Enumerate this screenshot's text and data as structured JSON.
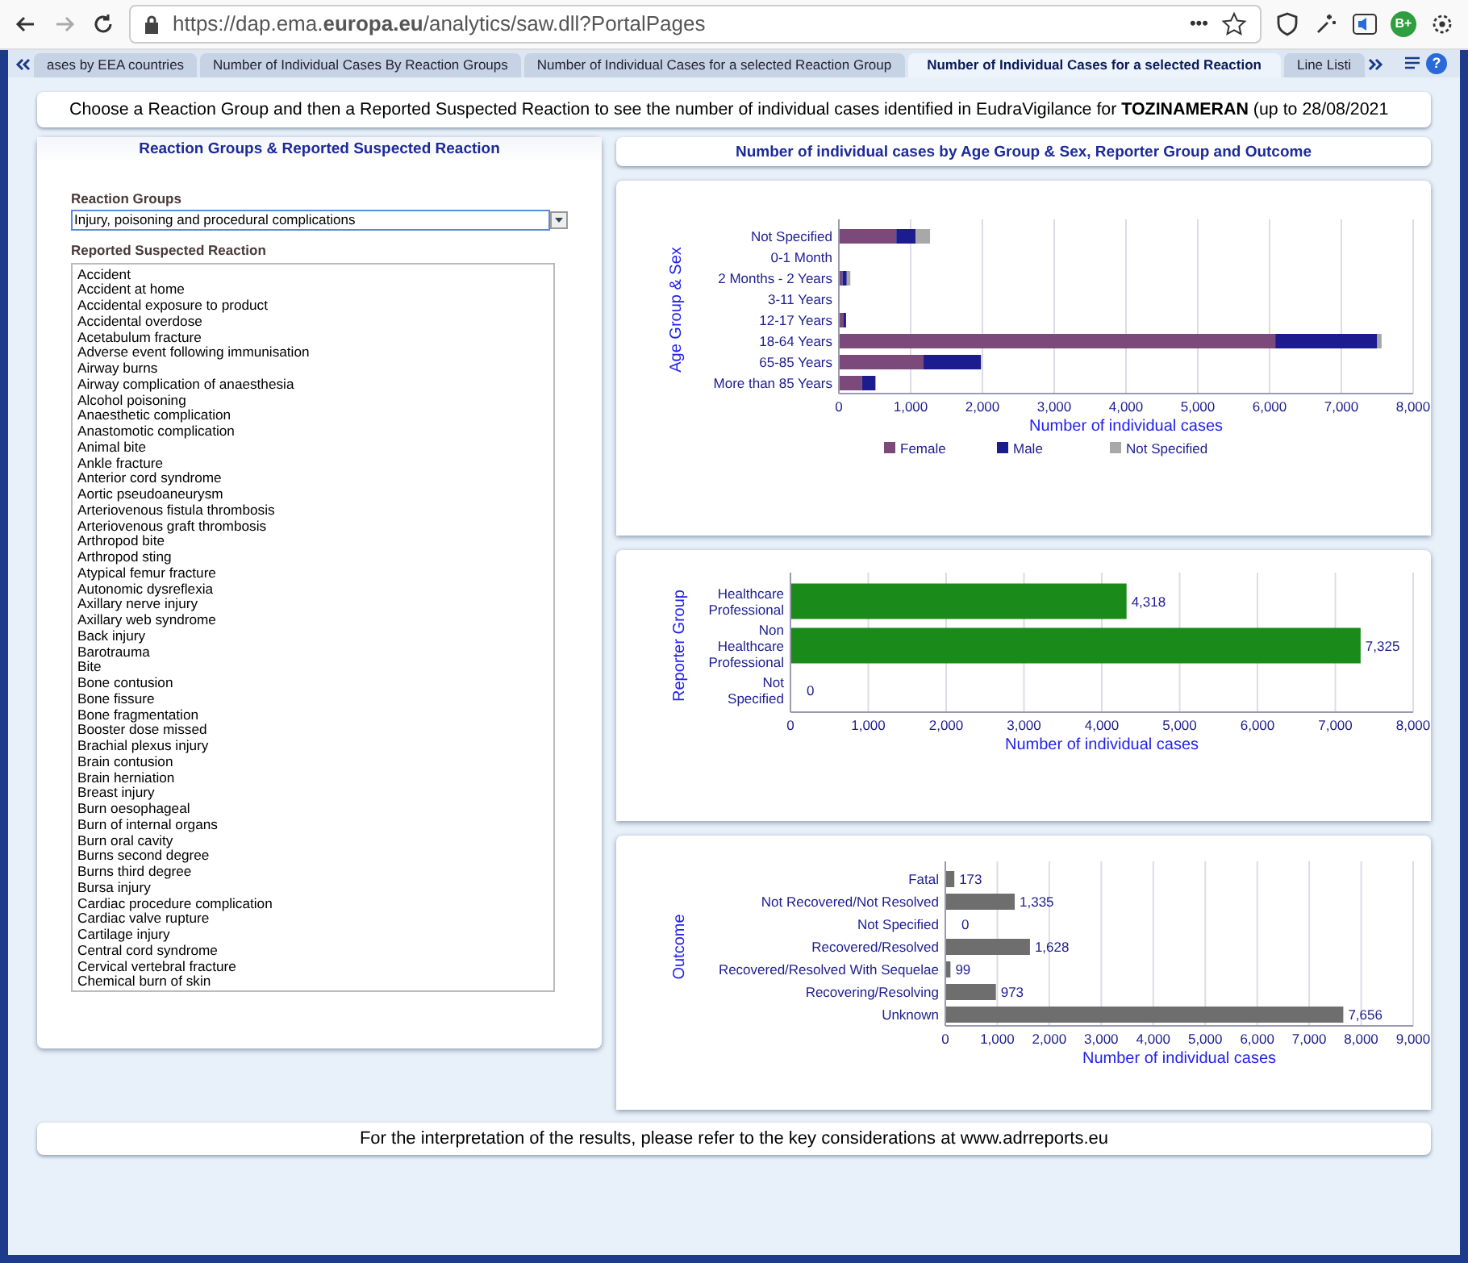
{
  "browser": {
    "url": "https://dap.ema.**europa.eu**/analytics/saw.dll?PortalPages",
    "more": "•••",
    "badge": "B+"
  },
  "tabs": [
    {
      "label": "ases by EEA countries",
      "selected": false
    },
    {
      "label": "Number of Individual Cases By Reaction Groups",
      "selected": false
    },
    {
      "label": "Number of Individual Cases for a selected Reaction Group",
      "selected": false
    },
    {
      "label": "Number of Individual Cases for a selected Reaction",
      "selected": true
    },
    {
      "label": "Line Listi",
      "selected": false
    }
  ],
  "help": "?",
  "intro": "Choose a Reaction Group and then a Reported Suspected Reaction to see the number of individual cases identified in EudraVigilance for **TOZINAMERAN** (up to 28/08/2021",
  "left_panel": {
    "title": "Reaction Groups & Reported Suspected Reaction",
    "group_label": "Reaction Groups",
    "group_value": "Injury, poisoning and procedural complications",
    "reaction_label": "Reported Suspected Reaction",
    "reactions": [
      "Accident",
      "Accident at home",
      "Accidental exposure to product",
      "Accidental overdose",
      "Acetabulum fracture",
      "Adverse event following immunisation",
      "Airway burns",
      "Airway complication of anaesthesia",
      "Alcohol poisoning",
      "Anaesthetic complication",
      "Anastomotic complication",
      "Animal bite",
      "Ankle fracture",
      "Anterior cord syndrome",
      "Aortic pseudoaneurysm",
      "Arteriovenous fistula thrombosis",
      "Arteriovenous graft thrombosis",
      "Arthropod bite",
      "Arthropod sting",
      "Atypical femur fracture",
      "Autonomic dysreflexia",
      "Axillary nerve injury",
      "Axillary web syndrome",
      "Back injury",
      "Barotrauma",
      "Bite",
      "Bone contusion",
      "Bone fissure",
      "Bone fragmentation",
      "Booster dose missed",
      "Brachial plexus injury",
      "Brain contusion",
      "Brain herniation",
      "Breast injury",
      "Burn oesophageal",
      "Burn of internal organs",
      "Burn oral cavity",
      "Burns second degree",
      "Burns third degree",
      "Bursa injury",
      "Cardiac procedure complication",
      "Cardiac valve rupture",
      "Cartilage injury",
      "Central cord syndrome",
      "Cervical vertebral fracture",
      "Chemical burn of skin"
    ]
  },
  "right_header": "Number of individual cases by Age Group & Sex, Reporter Group and Outcome",
  "charts": [
    {
      "chart_data": {
        "type": "bar",
        "orientation": "horizontal",
        "stacked": true,
        "grid": true,
        "legend": true,
        "xlabel": "Number of individual cases",
        "ylabel": "Age Group & Sex",
        "categories": [
          "Not Specified",
          "0-1 Month",
          "2 Months - 2 Years",
          "3-11 Years",
          "12-17 Years",
          "18-64 Years",
          "65-85 Years",
          "More than 85 Years"
        ],
        "series": [
          {
            "name": "Female",
            "color": "#7b4a7b",
            "values": [
              800,
              0,
              50,
              0,
              60,
              6080,
              1180,
              320
            ]
          },
          {
            "name": "Male",
            "color": "#1c1c8e",
            "values": [
              270,
              0,
              60,
              0,
              40,
              1420,
              800,
              190
            ]
          },
          {
            "name": "Not Specified",
            "color": "#a8a8a8",
            "values": [
              200,
              0,
              50,
              0,
              null,
              60,
              null,
              null
            ]
          }
        ],
        "xlim": [
          0,
          8000
        ],
        "xticks": [
          {
            "value": 0,
            "label": "0"
          },
          {
            "value": 1000,
            "label": "1,000"
          },
          {
            "value": 2000,
            "label": "2,000"
          },
          {
            "value": 3000,
            "label": "3,000"
          },
          {
            "value": 4000,
            "label": "4,000"
          },
          {
            "value": 5000,
            "label": "5,000"
          },
          {
            "value": 6000,
            "label": "6,000"
          },
          {
            "value": 7000,
            "label": "7,000"
          },
          {
            "value": 8000,
            "label": "8,000"
          }
        ]
      }
    },
    {
      "chart_data": {
        "type": "bar",
        "orientation": "horizontal",
        "grid": true,
        "xlabel": "Number of individual cases",
        "ylabel": "Reporter Group",
        "categories": [
          "Healthcare Professional",
          "Non Healthcare Professional",
          "Not Specified"
        ],
        "series": [
          {
            "color": "#1a8a1a",
            "values": [
              4318,
              7325,
              0
            ]
          }
        ],
        "value_labels": [
          "4,318",
          "7,325",
          "0"
        ],
        "xlim": [
          0,
          8000
        ],
        "xticks": [
          {
            "value": 0,
            "label": "0"
          },
          {
            "value": 1000,
            "label": "1,000"
          },
          {
            "value": 2000,
            "label": "2,000"
          },
          {
            "value": 3000,
            "label": "3,000"
          },
          {
            "value": 4000,
            "label": "4,000"
          },
          {
            "value": 5000,
            "label": "5,000"
          },
          {
            "value": 6000,
            "label": "6,000"
          },
          {
            "value": 7000,
            "label": "7,000"
          },
          {
            "value": 8000,
            "label": "8,000"
          }
        ]
      }
    },
    {
      "chart_data": {
        "type": "bar",
        "orientation": "horizontal",
        "grid": true,
        "xlabel": "Number of individual cases",
        "ylabel": "Outcome",
        "categories": [
          "Fatal",
          "Not Recovered/Not Resolved",
          "Not Specified",
          "Recovered/Resolved",
          "Recovered/Resolved With Sequelae",
          "Recovering/Resolving",
          "Unknown"
        ],
        "series": [
          {
            "color": "#6e6e6e",
            "values": [
              173,
              1335,
              0,
              1628,
              99,
              973,
              7656
            ]
          }
        ],
        "value_labels": [
          "173",
          "1,335",
          "0",
          "1,628",
          "99",
          "973",
          "7,656"
        ],
        "xlim": [
          0,
          9000
        ],
        "xticks": [
          {
            "value": 0,
            "label": "0"
          },
          {
            "value": 1000,
            "label": "1,000"
          },
          {
            "value": 2000,
            "label": "2,000"
          },
          {
            "value": 3000,
            "label": "3,000"
          },
          {
            "value": 4000,
            "label": "4,000"
          },
          {
            "value": 5000,
            "label": "5,000"
          },
          {
            "value": 6000,
            "label": "6,000"
          },
          {
            "value": 7000,
            "label": "7,000"
          },
          {
            "value": 8000,
            "label": "8,000"
          },
          {
            "value": 9000,
            "label": "9,000"
          }
        ]
      }
    }
  ],
  "footer": "For the interpretation of the results, please refer to the key considerations at www.adrreports.eu"
}
